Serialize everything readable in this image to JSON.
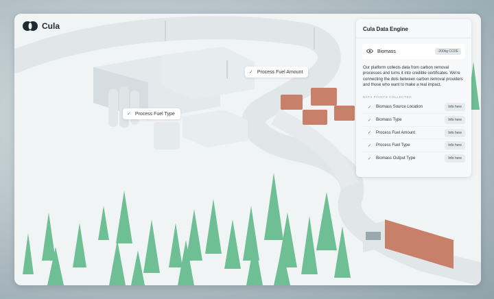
{
  "brand": {
    "name": "Cula"
  },
  "tags": {
    "fuel_amount": "Process Fuel Amount",
    "fuel_type": "Process Fuel Type"
  },
  "panel": {
    "title": "Cula Data Engine",
    "biomass": {
      "label": "Biomass",
      "badge": "-200kg CO2E"
    },
    "description": "Our platform collects data from carbon removal processes and turns it into credible certificates. We're connecting the dots between carbon removal providers and those who want to make a real impact.",
    "section_label": "DATA POINTS COLLECTED",
    "data_points": [
      {
        "label": "Biomass Source Location",
        "action": "Info here"
      },
      {
        "label": "Biomass Type",
        "action": "Info here"
      },
      {
        "label": "Process Fuel Amount",
        "action": "Info here"
      },
      {
        "label": "Process Fuel Type",
        "action": "Info here"
      },
      {
        "label": "Biomass Output Type",
        "action": "Info here"
      }
    ]
  },
  "colors": {
    "tree": "#6fbf95",
    "accent": "#1f2a30",
    "wood": "#c8806a"
  }
}
